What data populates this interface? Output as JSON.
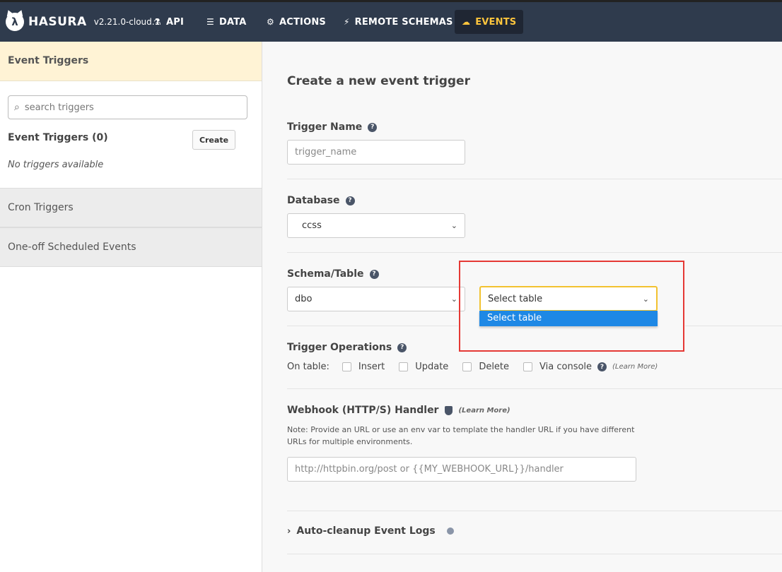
{
  "topbar": {
    "brand": "HASURA",
    "version": "v2.21.0-cloud.1",
    "nav": [
      {
        "label": "API",
        "icon": "flask-icon"
      },
      {
        "label": "DATA",
        "icon": "database-icon"
      },
      {
        "label": "ACTIONS",
        "icon": "cogs-icon"
      },
      {
        "label": "REMOTE SCHEMAS",
        "icon": "plug-icon"
      },
      {
        "label": "EVENTS",
        "icon": "cloud-icon",
        "active": true
      }
    ]
  },
  "sidebar": {
    "header": "Event Triggers",
    "search_placeholder": "search triggers",
    "count_label": "Event Triggers (0)",
    "create_label": "Create",
    "empty_text": "No triggers available",
    "sections": [
      "Cron Triggers",
      "One-off Scheduled Events"
    ]
  },
  "form": {
    "title": "Create a new event trigger",
    "trigger_name": {
      "label": "Trigger Name",
      "placeholder": "trigger_name"
    },
    "database": {
      "label": "Database",
      "value": "ccss"
    },
    "schema_table": {
      "label": "Schema/Table",
      "schema_value": "dbo",
      "table_value": "Select table",
      "table_options": [
        "Select table"
      ]
    },
    "operations": {
      "label": "Trigger Operations",
      "prefix": "On table:",
      "options": [
        "Insert",
        "Update",
        "Delete",
        "Via console"
      ],
      "learn_more": "(Learn More)"
    },
    "webhook": {
      "label": "Webhook (HTTP/S) Handler",
      "learn_more": "(Learn More)",
      "note": "Note: Provide an URL or use an env var to template the handler URL if you have different URLs for multiple environments.",
      "placeholder": "http://httpbin.org/post or {{MY_WEBHOOK_URL}}/handler"
    },
    "auto_cleanup": {
      "label": "Auto-cleanup Event Logs"
    }
  },
  "colors": {
    "nav_bg": "#2f3b4d",
    "active": "#fec53d",
    "highlight": "#e53935",
    "option_bg": "#1e88e5"
  }
}
